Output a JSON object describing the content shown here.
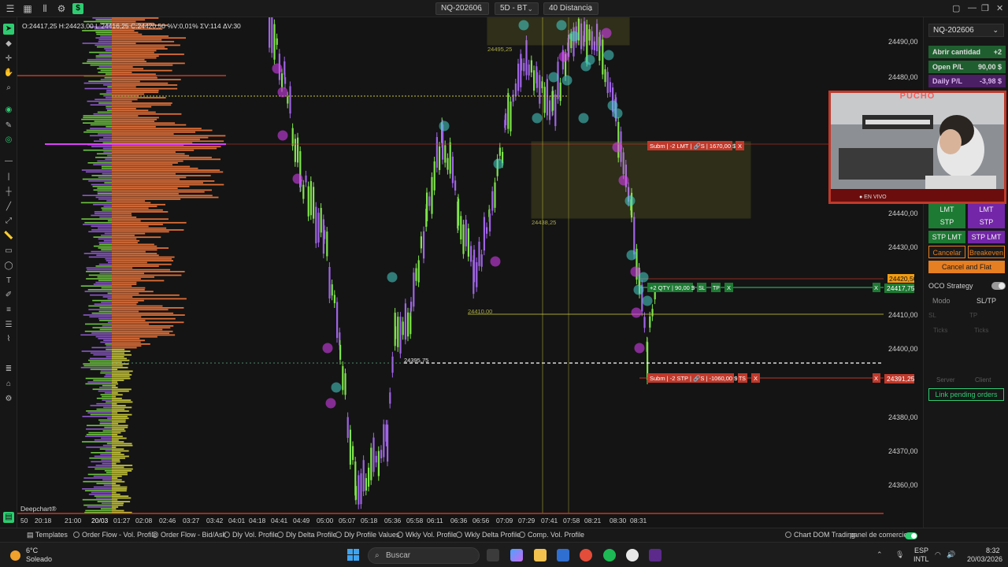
{
  "topbar": {
    "symbol": "NQ-202606",
    "timeframe": "5D - BT",
    "range": "40 Distancia"
  },
  "chart": {
    "info_line": "O:24417,25  H:24423,00  L:24416,25  C:24420,50  %V:0,01%  ΣV:114  ΔV:30",
    "price_labels": [
      "24490,00",
      "24480,00",
      "24440,00",
      "24430,00",
      "24410,00",
      "24400,00",
      "24380,00",
      "24370,00",
      "24360,00"
    ],
    "time_labels": [
      "20:18",
      "21:00",
      "20/03",
      "01:27",
      "02:08",
      "02:46",
      "03:27",
      "03:42",
      "04:01",
      "04:18",
      "04:41",
      "04:49",
      "05:00",
      "05:07",
      "05:18",
      "05:36",
      "05:58",
      "06:11",
      "06:36",
      "06:56",
      "07:09",
      "07:29",
      "07:41",
      "07:58",
      "08:21",
      "08:30",
      "08:31"
    ],
    "time_label_first": "50",
    "level_labels": {
      "zone_top": "24495,25",
      "zone_mid": "24438,25",
      "level_24410": "24410,00",
      "level_24395": "24395,75"
    },
    "order_sell_limit": "Subm | -2 LMT | 🔗S | 1670,00 $",
    "order_position": "+2 QTY | 90,00 $",
    "order_stop": "Subm | -2 STP | 🔗S | -1060,00 $",
    "badge_last": "24420,50",
    "badge_position": "24417,75",
    "badge_stop": "24391,25",
    "btn_sl": "SL",
    "btn_tp": "TP",
    "btn_ts": "TS",
    "btn_x": "X",
    "watermark": "Deepchart®"
  },
  "panel": {
    "symbol": "NQ-202606",
    "qty_label": "Abrir cantidad",
    "qty_value": "+2",
    "openpl_label": "Open P/L",
    "openpl_value": "90,00 $",
    "daily_label": "Daily P/L",
    "daily_value": "-3,98 $",
    "lmt": "LMT",
    "stp": "STP",
    "stplmt": "STP LMT",
    "cancel": "Cancelar",
    "breakeven": "Breakeven",
    "cancel_flat": "Cancel and Flat",
    "oco": "OCO Strategy",
    "mode_label": "Modo",
    "mode_value": "SL/TP",
    "sl": "SL",
    "tp": "TP",
    "ticks": "Ticks",
    "server": "Server",
    "client": "Client",
    "link_pending": "Link pending orders"
  },
  "webcam": {
    "title": "PUCHO",
    "live": "● EN VIVO"
  },
  "bottom_tabs": {
    "templates": "Templates",
    "items": [
      "Order Flow - Vol. Profile",
      "Order Flow - Bid/Ask",
      "Dly Vol. Profile",
      "Dly Delta Profile",
      "Dly Profile Values",
      "Wkly Vol. Profile",
      "Wkly Delta Profile",
      "Comp. Vol. Profile"
    ],
    "chart_dom": "Chart DOM Trading",
    "panel_comercio": "panel de comercio"
  },
  "taskbar": {
    "temp": "6°C",
    "weather": "Soleado",
    "search": "Buscar",
    "lang": "ESP",
    "layout": "INTL",
    "time": "8:32",
    "date": "20/03/2026"
  },
  "colors": {
    "bull": "#7fe44b",
    "bear": "#a064e6",
    "profile": "#e8733a",
    "zone": "#c8c83c",
    "sell": "#e0524a",
    "buy": "#2ecc71"
  }
}
